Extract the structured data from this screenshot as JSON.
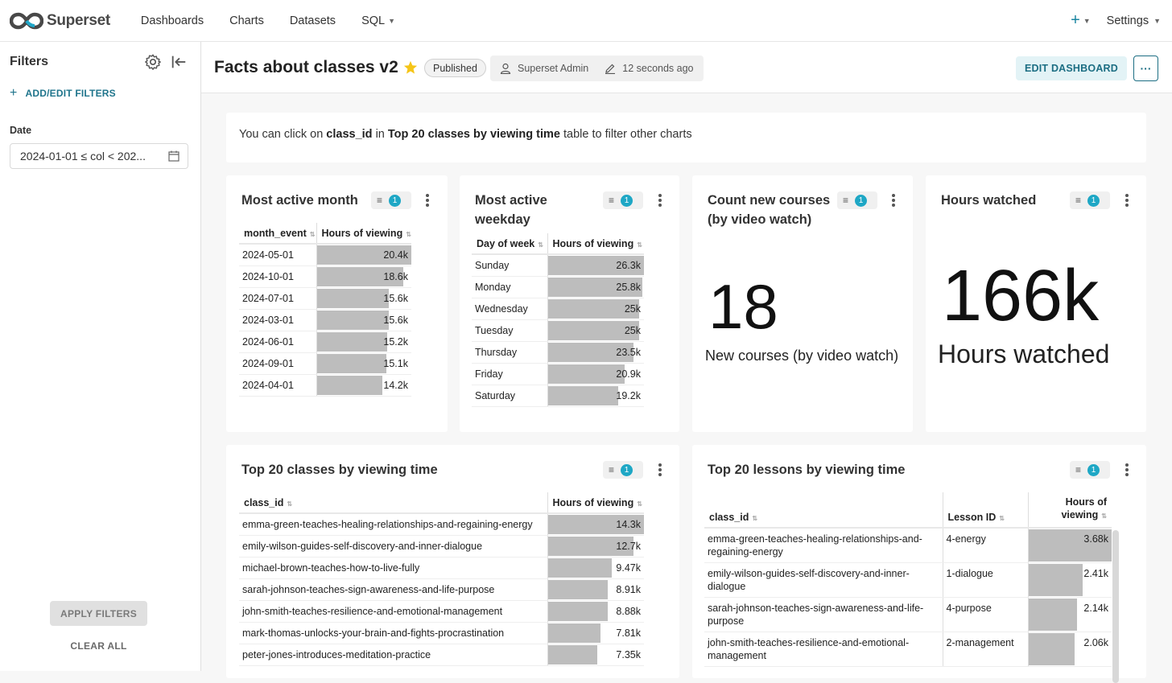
{
  "nav": {
    "logo_text": "Superset",
    "links": [
      "Dashboards",
      "Charts",
      "Datasets",
      "SQL"
    ],
    "settings_label": "Settings"
  },
  "sidebar": {
    "title": "Filters",
    "add_edit_label": "ADD/EDIT FILTERS",
    "date_label": "Date",
    "date_value": "2024-01-01 ≤ col < 202...",
    "apply_label": "APPLY FILTERS",
    "clear_label": "CLEAR ALL"
  },
  "header": {
    "title": "Facts about classes v2",
    "status_badge": "Published",
    "owner": "Superset Admin",
    "modified": "12 seconds ago",
    "edit_label": "EDIT DASHBOARD",
    "more_label": "···"
  },
  "markdown": {
    "t1": "You can click on ",
    "b1": "class_id",
    "t2": " in ",
    "b2": "Top 20 classes by viewing time",
    "t3": " table to filter other charts"
  },
  "charts": {
    "month": {
      "title": "Most active month",
      "filter_count": "1",
      "col1": "month_event",
      "col2": "Hours of viewing",
      "rows": [
        {
          "label": "2024-05-01",
          "value": "20.4k",
          "frac": 1.0
        },
        {
          "label": "2024-10-01",
          "value": "18.6k",
          "frac": 0.912
        },
        {
          "label": "2024-07-01",
          "value": "15.6k",
          "frac": 0.765
        },
        {
          "label": "2024-03-01",
          "value": "15.6k",
          "frac": 0.765
        },
        {
          "label": "2024-06-01",
          "value": "15.2k",
          "frac": 0.745
        },
        {
          "label": "2024-09-01",
          "value": "15.1k",
          "frac": 0.74
        },
        {
          "label": "2024-04-01",
          "value": "14.2k",
          "frac": 0.696
        }
      ]
    },
    "weekday": {
      "title_line1": "Most active",
      "title_line2": "weekday",
      "filter_count": "1",
      "col1": "Day of week",
      "col2": "Hours of viewing",
      "rows": [
        {
          "label": "Sunday",
          "value": "26.3k",
          "frac": 1.0
        },
        {
          "label": "Monday",
          "value": "25.8k",
          "frac": 0.981
        },
        {
          "label": "Wednesday",
          "value": "25k",
          "frac": 0.951
        },
        {
          "label": "Tuesday",
          "value": "25k",
          "frac": 0.951
        },
        {
          "label": "Thursday",
          "value": "23.5k",
          "frac": 0.894
        },
        {
          "label": "Friday",
          "value": "20.9k",
          "frac": 0.795
        },
        {
          "label": "Saturday",
          "value": "19.2k",
          "frac": 0.73
        }
      ]
    },
    "new_courses": {
      "title_line1": "Count new courses",
      "title_line2": "(by video watch)",
      "filter_count": "1",
      "big_number": "18",
      "subheader": "New courses (by video watch)"
    },
    "hours": {
      "title": "Hours watched",
      "filter_count": "1",
      "big_number": "166k",
      "subheader": "Hours watched"
    },
    "top_classes": {
      "title": "Top 20 classes by viewing time",
      "filter_count": "1",
      "col1": "class_id",
      "col2": "Hours of viewing",
      "rows": [
        {
          "label": "emma-green-teaches-healing-relationships-and-regaining-energy",
          "value": "14.3k",
          "frac": 1.0
        },
        {
          "label": "emily-wilson-guides-self-discovery-and-inner-dialogue",
          "value": "12.7k",
          "frac": 0.888
        },
        {
          "label": "michael-brown-teaches-how-to-live-fully",
          "value": "9.47k",
          "frac": 0.662
        },
        {
          "label": "sarah-johnson-teaches-sign-awareness-and-life-purpose",
          "value": "8.91k",
          "frac": 0.623
        },
        {
          "label": "john-smith-teaches-resilience-and-emotional-management",
          "value": "8.88k",
          "frac": 0.621
        },
        {
          "label": "mark-thomas-unlocks-your-brain-and-fights-procrastination",
          "value": "7.81k",
          "frac": 0.546
        },
        {
          "label": "peter-jones-introduces-meditation-practice",
          "value": "7.35k",
          "frac": 0.514
        }
      ]
    },
    "top_lessons": {
      "title": "Top 20 lessons by viewing time",
      "filter_count": "1",
      "col1": "class_id",
      "col2": "Lesson ID",
      "col3_line1": "Hours of",
      "col3_line2": "viewing",
      "rows": [
        {
          "label": "emma-green-teaches-healing-relationships-and-regaining-energy",
          "lesson": "4-energy",
          "value": "3.68k",
          "frac": 1.0
        },
        {
          "label": "emily-wilson-guides-self-discovery-and-inner-dialogue",
          "lesson": "1-dialogue",
          "value": "2.41k",
          "frac": 0.655
        },
        {
          "label": "sarah-johnson-teaches-sign-awareness-and-life-purpose",
          "lesson": "4-purpose",
          "value": "2.14k",
          "frac": 0.582
        },
        {
          "label": "john-smith-teaches-resilience-and-emotional-management",
          "lesson": "2-management",
          "value": "2.06k",
          "frac": 0.56
        }
      ]
    }
  },
  "colors": {
    "accent": "#1ea7c5",
    "link": "#20758c",
    "bar": "#bdbdbd",
    "star": "#f5c518"
  }
}
